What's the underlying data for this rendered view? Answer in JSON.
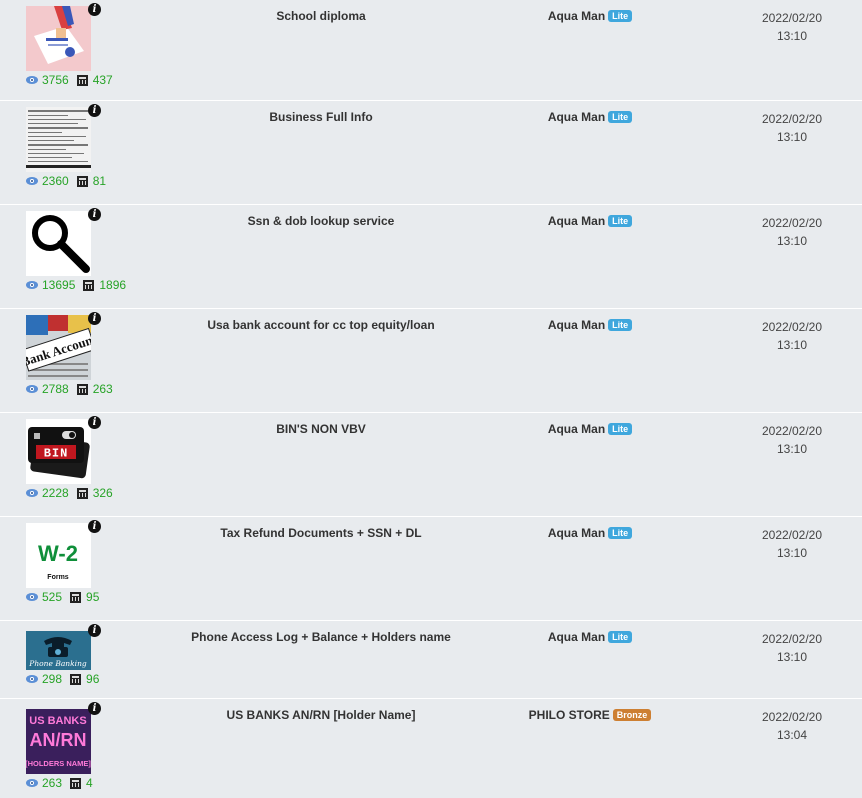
{
  "colors": {
    "lite": "#3fa7dd",
    "bronze": "#cd7f32",
    "stats": "#27a327"
  },
  "rows": [
    {
      "thumb": "diploma-thumbnail",
      "views": "3756",
      "sales": "437",
      "title": "School diploma",
      "seller": "Aqua Man",
      "badge": "Lite",
      "date": "2022/02/20",
      "time": "13:10"
    },
    {
      "thumb": "document-scan-thumbnail",
      "views": "2360",
      "sales": "81",
      "title": "Business Full Info",
      "seller": "Aqua Man",
      "badge": "Lite",
      "date": "2022/02/20",
      "time": "13:10"
    },
    {
      "thumb": "magnifier-thumbnail",
      "views": "13695",
      "sales": "1896",
      "title": "Ssn & dob lookup service",
      "seller": "Aqua Man",
      "badge": "Lite",
      "date": "2022/02/20",
      "time": "13:10"
    },
    {
      "thumb": "bank-account-thumbnail",
      "thumb_text": "Bank Account",
      "views": "2788",
      "sales": "263",
      "title": "Usa bank account for cc top equity/loan",
      "seller": "Aqua Man",
      "badge": "Lite",
      "date": "2022/02/20",
      "time": "13:10"
    },
    {
      "thumb": "bin-card-thumbnail",
      "thumb_text": "BIN",
      "views": "2228",
      "sales": "326",
      "title": "BIN'S NON VBV",
      "seller": "Aqua Man",
      "badge": "Lite",
      "date": "2022/02/20",
      "time": "13:10"
    },
    {
      "thumb": "w2-form-thumbnail",
      "thumb_text": "W-2",
      "thumb_subtext": "Forms",
      "views": "525",
      "sales": "95",
      "title": "Tax Refund Documents + SSN + DL",
      "seller": "Aqua Man",
      "badge": "Lite",
      "date": "2022/02/20",
      "time": "13:10"
    },
    {
      "thumb": "phone-banking-thumbnail",
      "thumb_text": "Phone Banking",
      "views": "298",
      "sales": "96",
      "title": "Phone Access Log + Balance + Holders name",
      "seller": "Aqua Man",
      "badge": "Lite",
      "date": "2022/02/20",
      "time": "13:10"
    },
    {
      "thumb": "us-banks-thumbnail",
      "thumb_text": "US BANKS",
      "thumb_text2": "AN/RN",
      "thumb_text3": "[HOLDERS NAME]",
      "views": "263",
      "sales": "4",
      "title": "US BANKS AN/RN [Holder Name]",
      "seller": "PHILO STORE",
      "badge": "Bronze",
      "date": "2022/02/20",
      "time": "13:04"
    }
  ]
}
